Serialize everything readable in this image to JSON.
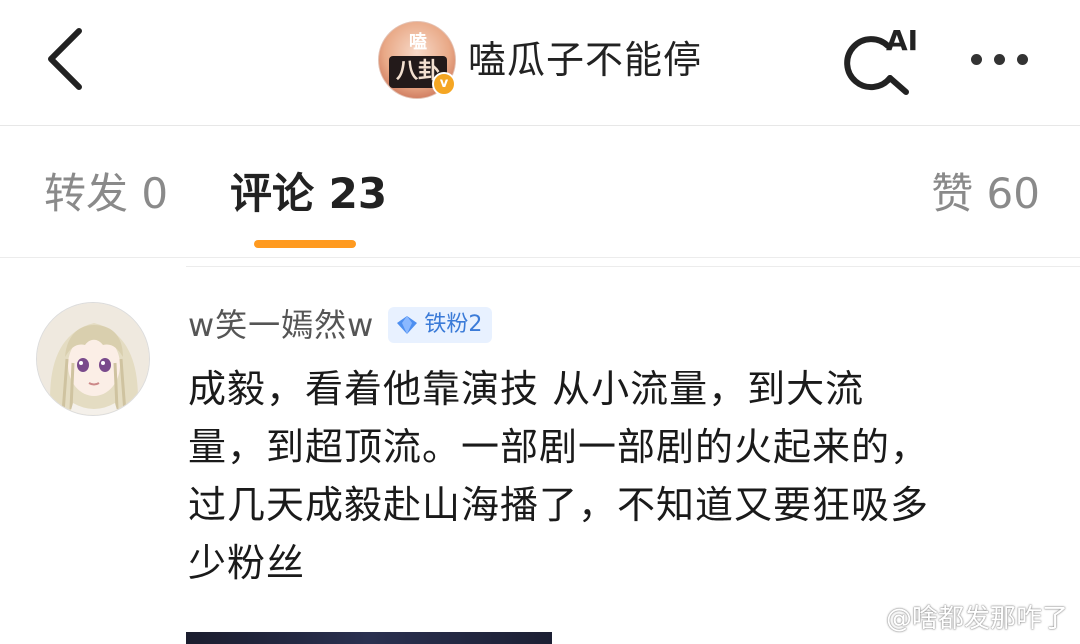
{
  "header": {
    "channel": {
      "name": "嗑瓜子不能停",
      "avatar_top_text": "嗑",
      "avatar_main_text": "八卦",
      "verified_mark": "v"
    },
    "ai_label": "AI",
    "icons": [
      "back-chevron-icon",
      "ai-search-icon",
      "more-icon"
    ]
  },
  "tabs": {
    "repost": "转发 0",
    "comment": "评论 23",
    "like": "赞 60",
    "active_color": "#ff9a1f"
  },
  "comment": {
    "username": "w笑一嫣然w",
    "badge": "铁粉2",
    "badge_color": "#3b7bd8",
    "lines": [
      "成毅，看着他靠演技 从小流量，到大流",
      "量，到超顶流。一部剧一部剧的火起来的，",
      "过几天成毅赴山海播了，不知道又要狂吸多",
      "少粉丝"
    ]
  },
  "watermark": {
    "text": "@啥都发那咋了"
  }
}
